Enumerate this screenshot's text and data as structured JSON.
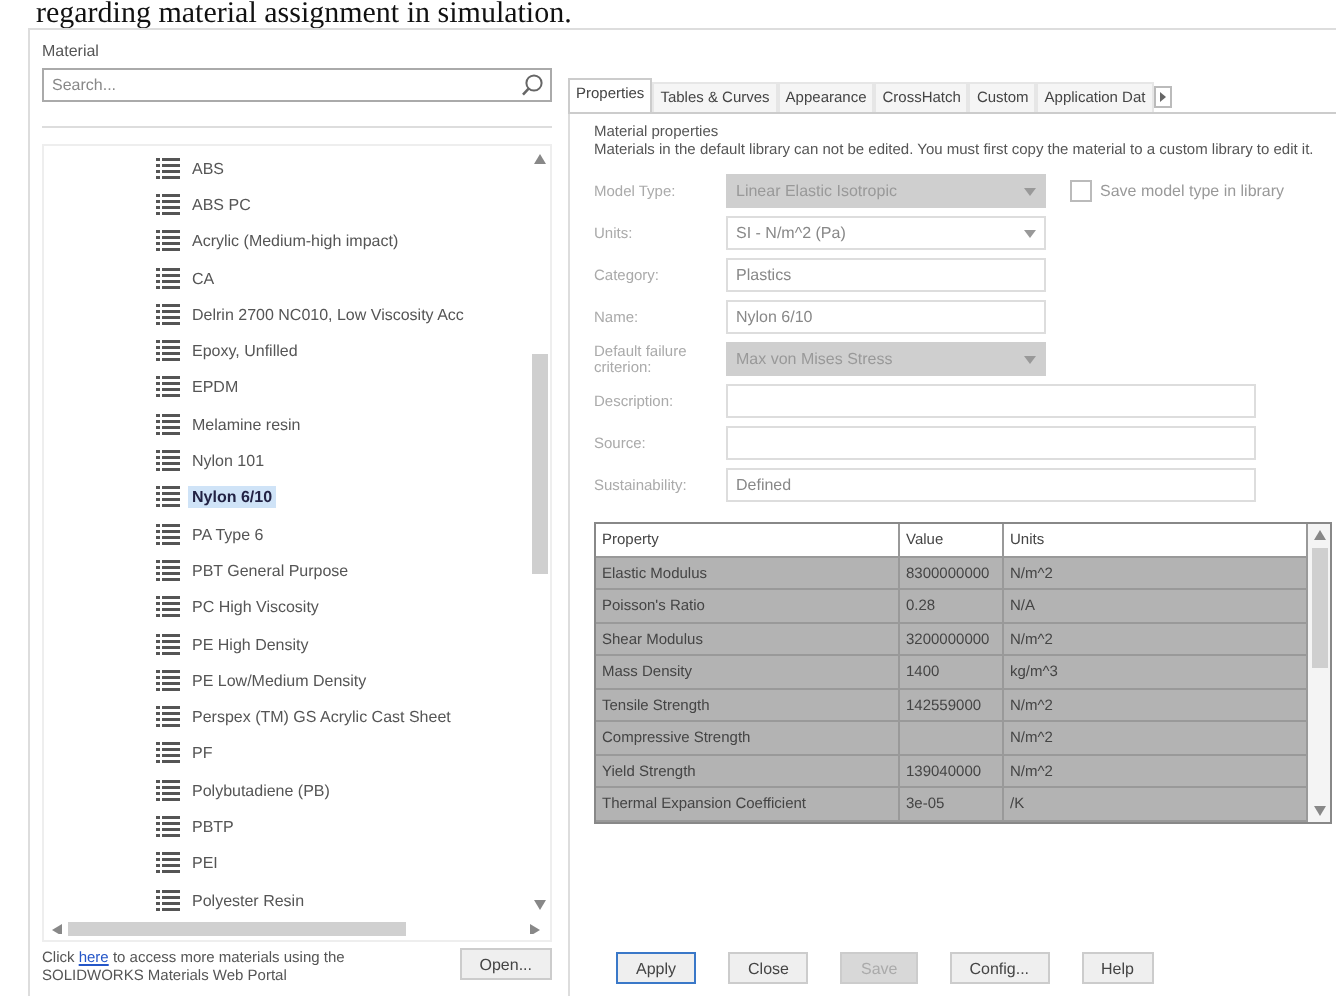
{
  "caption": "regarding material assignment in simulation.",
  "window": {
    "title": "Material"
  },
  "search": {
    "placeholder": "Search..."
  },
  "tree": {
    "items": [
      {
        "label": "ABS",
        "selected": false
      },
      {
        "label": "ABS PC",
        "selected": false
      },
      {
        "label": "Acrylic (Medium-high impact)",
        "selected": false
      },
      {
        "label": "CA",
        "selected": false
      },
      {
        "label": "Delrin 2700 NC010, Low Viscosity Acc",
        "selected": false
      },
      {
        "label": "Epoxy, Unfilled",
        "selected": false
      },
      {
        "label": "EPDM",
        "selected": false
      },
      {
        "label": "Melamine resin",
        "selected": false
      },
      {
        "label": "Nylon 101",
        "selected": false
      },
      {
        "label": "Nylon 6/10",
        "selected": true
      },
      {
        "label": "PA Type 6",
        "selected": false
      },
      {
        "label": "PBT General Purpose",
        "selected": false
      },
      {
        "label": "PC High Viscosity",
        "selected": false
      },
      {
        "label": "PE High Density",
        "selected": false
      },
      {
        "label": "PE Low/Medium Density",
        "selected": false
      },
      {
        "label": "Perspex (TM) GS Acrylic Cast Sheet",
        "selected": false
      },
      {
        "label": "PF",
        "selected": false
      },
      {
        "label": "Polybutadiene (PB)",
        "selected": false
      },
      {
        "label": "PBTP",
        "selected": false
      },
      {
        "label": "PEI",
        "selected": false
      },
      {
        "label": "Polyester Resin",
        "selected": false
      }
    ]
  },
  "hint": {
    "before": "Click ",
    "link": "here",
    "after": " to access more materials using the SOLIDWORKS Materials Web Portal"
  },
  "open_button": "Open...",
  "tabs": [
    {
      "label": "Properties",
      "selected": true
    },
    {
      "label": "Tables & Curves",
      "selected": false
    },
    {
      "label": "Appearance",
      "selected": false
    },
    {
      "label": "CrossHatch",
      "selected": false
    },
    {
      "label": "Custom",
      "selected": false
    },
    {
      "label": "Application Dat",
      "selected": false
    }
  ],
  "properties": {
    "heading": "Material properties",
    "note": "Materials in the default library can not be edited. You must first copy the material to a custom library to edit it.",
    "fields": [
      {
        "kind": "select",
        "label": "Model Type:",
        "value": "Linear Elastic Isotropic",
        "disabled": true
      },
      {
        "kind": "select",
        "label": "Units:",
        "value": "SI - N/m^2 (Pa)",
        "disabled": false
      },
      {
        "kind": "text",
        "label": "Category:",
        "value": "Plastics"
      },
      {
        "kind": "text",
        "label": "Name:",
        "value": "Nylon 6/10"
      },
      {
        "kind": "select",
        "label": "Default failure criterion:",
        "value": "Max von Mises Stress",
        "disabled": true
      },
      {
        "kind": "wide",
        "label": "Description:"
      },
      {
        "kind": "wide",
        "label": "Source:"
      },
      {
        "kind": "wide",
        "label": "Sustainability:",
        "value": "Defined"
      }
    ],
    "save_type": {
      "label": "Save model type in library",
      "checked": false
    }
  },
  "table": {
    "columns": [
      "Property",
      "Value",
      "Units"
    ],
    "rows": [
      [
        "Elastic Modulus",
        "8300000000",
        "N/m^2"
      ],
      [
        "Poisson's Ratio",
        "0.28",
        "N/A"
      ],
      [
        "Shear Modulus",
        "3200000000",
        "N/m^2"
      ],
      [
        "Mass Density",
        "1400",
        "kg/m^3"
      ],
      [
        "Tensile Strength",
        "142559000",
        "N/m^2"
      ],
      [
        "Compressive Strength",
        null,
        "N/m^2"
      ],
      [
        "Yield Strength",
        "139040000",
        "N/m^2"
      ],
      [
        "Thermal Expansion Coefficient",
        "3e-05",
        "/K"
      ]
    ]
  },
  "buttons": [
    {
      "label": "Apply",
      "disabled": false,
      "default": true
    },
    {
      "label": "Close",
      "disabled": false,
      "default": false
    },
    {
      "label": "Save",
      "disabled": true,
      "default": false
    },
    {
      "label": "Config...",
      "disabled": false,
      "default": false
    },
    {
      "label": "Help",
      "disabled": false,
      "default": false
    }
  ]
}
